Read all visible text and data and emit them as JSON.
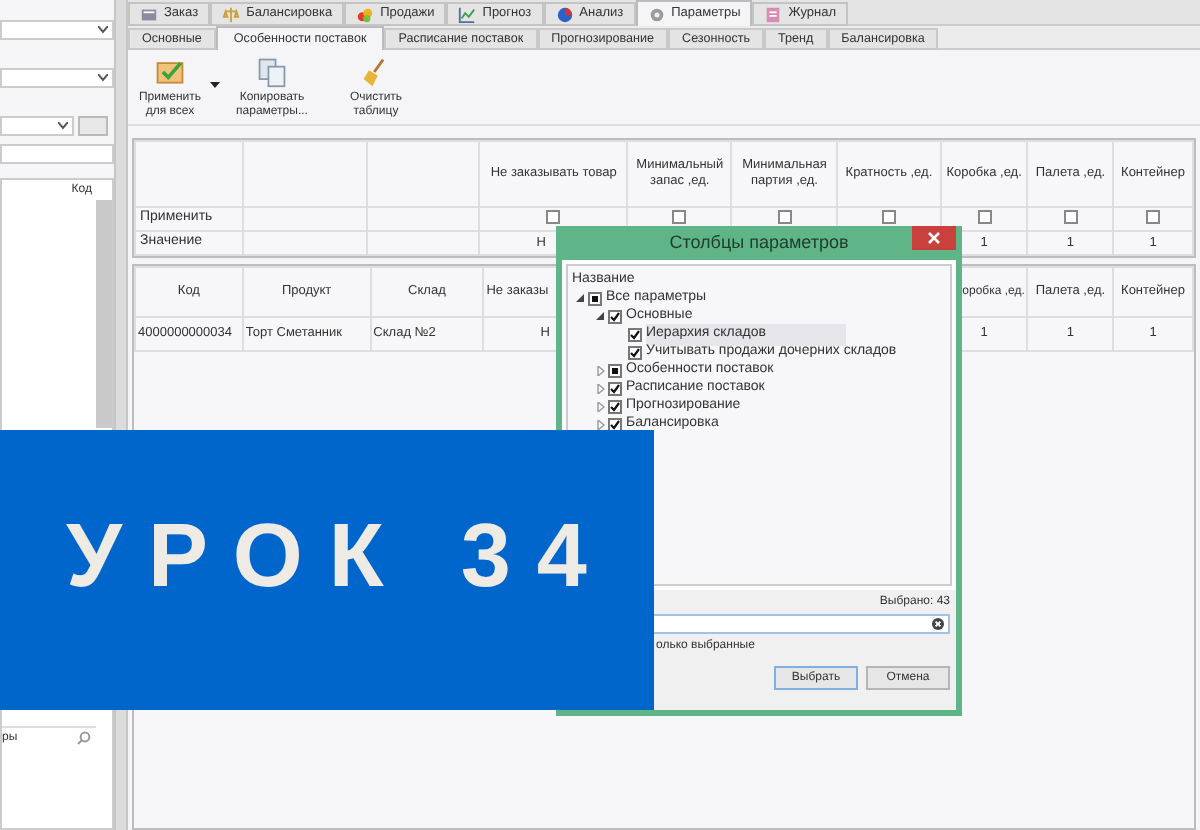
{
  "left_panel": {
    "list_header": "Код",
    "search_text": "ры"
  },
  "main_tabs": [
    {
      "label": "Заказ",
      "selected": false
    },
    {
      "label": "Балансировка",
      "selected": false
    },
    {
      "label": "Продажи",
      "selected": false
    },
    {
      "label": "Прогноз",
      "selected": false
    },
    {
      "label": "Анализ",
      "selected": false
    },
    {
      "label": "Параметры",
      "selected": true
    },
    {
      "label": "Журнал",
      "selected": false
    }
  ],
  "sub_tabs": [
    {
      "label": "Основные",
      "selected": false
    },
    {
      "label": "Особенности поставок",
      "selected": true
    },
    {
      "label": "Расписание поставок",
      "selected": false
    },
    {
      "label": "Прогнозирование",
      "selected": false
    },
    {
      "label": "Сезонность",
      "selected": false
    },
    {
      "label": "Тренд",
      "selected": false
    },
    {
      "label": "Балансировка",
      "selected": false
    }
  ],
  "toolbar": [
    {
      "label": "Применить для всех",
      "dropdown": true
    },
    {
      "label": "Копировать параметры..."
    },
    {
      "label": "Очистить таблицу"
    }
  ],
  "params_grid": {
    "columns": [
      "",
      "",
      "",
      "Не заказывать товар",
      "Минимальный запас ,ед.",
      "Минимальная партия ,ед.",
      "Кратность ,ед.",
      "Коробка ,ед.",
      "Палета ,ед.",
      "Контейнер"
    ],
    "rows": [
      {
        "cells": [
          {
            "kind": "label",
            "text": "Применить"
          },
          {
            "kind": "blank"
          },
          {
            "kind": "blank"
          },
          {
            "kind": "checkbox",
            "checked": false
          },
          {
            "kind": "checkbox",
            "checked": false
          },
          {
            "kind": "checkbox",
            "checked": false
          },
          {
            "kind": "checkbox",
            "checked": false
          },
          {
            "kind": "checkbox",
            "checked": false
          },
          {
            "kind": "checkbox",
            "checked": false
          },
          {
            "kind": "checkbox",
            "checked": false
          }
        ]
      },
      {
        "cells": [
          {
            "kind": "label",
            "text": "Значение"
          },
          {
            "kind": "blank"
          },
          {
            "kind": "blank"
          },
          {
            "kind": "text",
            "text": "Н"
          },
          {
            "kind": "blank"
          },
          {
            "kind": "blank"
          },
          {
            "kind": "blank"
          },
          {
            "kind": "text",
            "text": "1"
          },
          {
            "kind": "text",
            "text": "1"
          },
          {
            "kind": "text",
            "text": "1"
          }
        ]
      }
    ]
  },
  "products_grid": {
    "columns": [
      "Код",
      "Продукт",
      "Склад",
      "Не заказы",
      "",
      "",
      "",
      "оробка ,ед.",
      "Палета ,ед.",
      "Контейнер"
    ],
    "rows": [
      {
        "cells": [
          "4000000000034",
          "Торт Сметанник",
          "Склад №2",
          "Н",
          "",
          "",
          "",
          "1",
          "1",
          "1"
        ]
      }
    ]
  },
  "dialog": {
    "title": "Столбцы параметров",
    "tree_header": "Название",
    "tree": [
      {
        "label": "Все параметры",
        "checked": false,
        "partial": true,
        "expanded": true,
        "selected": false,
        "children": [
          {
            "label": "Основные",
            "checked": true,
            "partial": false,
            "expanded": true,
            "selected": false,
            "children": [
              {
                "label": "Иерархия складов",
                "checked": true,
                "partial": false,
                "selected": true
              },
              {
                "label": "Учитывать продажи дочерних складов",
                "checked": true,
                "partial": false,
                "selected": false
              }
            ]
          },
          {
            "label": "Особенности поставок",
            "checked": false,
            "partial": true,
            "expanded": false,
            "selected": false
          },
          {
            "label": "Расписание поставок",
            "checked": true,
            "partial": false,
            "expanded": false,
            "selected": false
          },
          {
            "label": "Прогнозирование",
            "checked": true,
            "partial": false,
            "expanded": false,
            "selected": false
          },
          {
            "label": "Балансировка",
            "checked": true,
            "partial": false,
            "expanded": false,
            "selected": false
          }
        ]
      }
    ],
    "selected_count": "Выбрано: 43",
    "only_selected_label": "олько выбранные",
    "buttons": [
      {
        "label": "Выбрать",
        "default": true
      },
      {
        "label": "Отмена",
        "default": false
      }
    ]
  },
  "banner": {
    "text": "УРОК 34"
  }
}
